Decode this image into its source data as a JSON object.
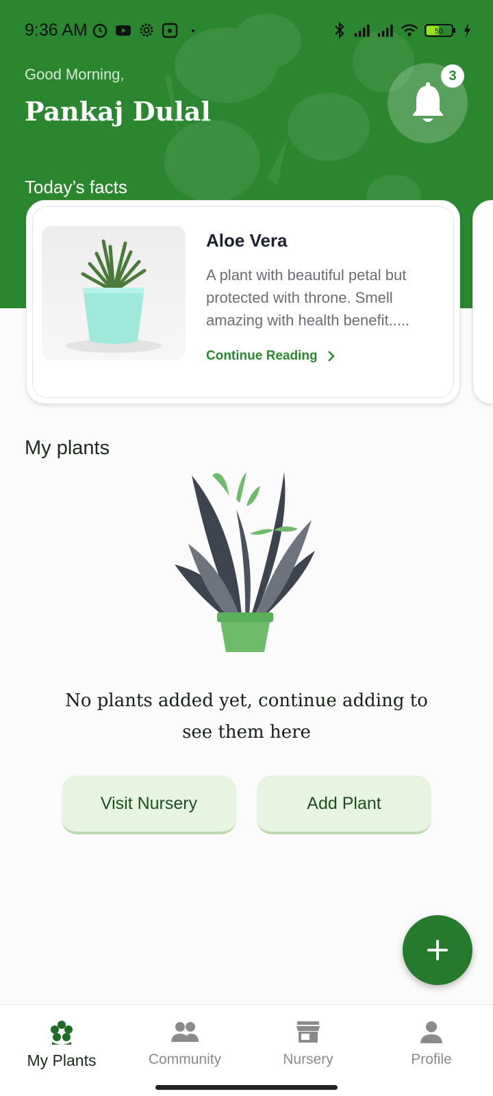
{
  "status_bar": {
    "time": "9:36 AM",
    "battery": "50"
  },
  "header": {
    "greeting": "Good Morning,",
    "user_name": "Pankaj Dulal",
    "notification_count": "3"
  },
  "facts": {
    "section_title": "Today’s facts",
    "card": {
      "title": "Aloe Vera",
      "description": "A plant with beautiful petal but protected with throne. Smell amazing with health benefit.....",
      "link_label": "Continue Reading"
    }
  },
  "my_plants": {
    "section_title": "My plants",
    "empty_message": "No plants added yet, continue adding to see them here",
    "visit_button": "Visit Nursery",
    "add_button": "Add Plant"
  },
  "bottom_nav": {
    "items": [
      {
        "label": "My Plants",
        "icon": "flower-icon",
        "active": true
      },
      {
        "label": "Community",
        "icon": "people-icon",
        "active": false
      },
      {
        "label": "Nursery",
        "icon": "store-icon",
        "active": false
      },
      {
        "label": "Profile",
        "icon": "person-icon",
        "active": false
      }
    ]
  },
  "colors": {
    "primary": "#2a862f",
    "button_bg": "#e7f4df",
    "fab": "#267a2b"
  }
}
